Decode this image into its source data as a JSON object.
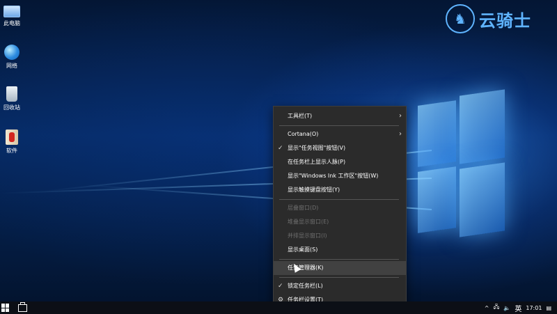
{
  "watermark": {
    "text": "云骑士",
    "logo_icon": "horse-rider-icon"
  },
  "desktop_icons": [
    {
      "label": "此电脑",
      "icon": "computer-icon"
    },
    {
      "label": "网络",
      "icon": "network-icon"
    },
    {
      "label": "回收站",
      "icon": "recycle-bin-icon"
    },
    {
      "label": "软件",
      "icon": "software-folder-icon"
    }
  ],
  "context_menu": {
    "items": [
      {
        "label": "工具栏(T)",
        "submenu": true
      },
      {
        "label": "Cortana(O)",
        "submenu": true
      },
      {
        "label": "显示\"任务视图\"按钮(V)",
        "checked": true
      },
      {
        "label": "在任务栏上显示人脉(P)"
      },
      {
        "label": "显示\"Windows Ink 工作区\"按钮(W)"
      },
      {
        "label": "显示触摸键盘按钮(Y)"
      },
      {
        "label": "层叠窗口(D)",
        "disabled": true
      },
      {
        "label": "堆叠显示窗口(E)",
        "disabled": true
      },
      {
        "label": "并排显示窗口(I)",
        "disabled": true
      },
      {
        "label": "显示桌面(S)"
      },
      {
        "label": "任务管理器(K)",
        "hovered": true
      },
      {
        "label": "锁定任务栏(L)",
        "checked": true
      },
      {
        "label": "任务栏设置(T)",
        "icon": "gear-icon"
      }
    ]
  },
  "taskbar": {
    "tray": {
      "chevron": "^",
      "language": "英",
      "time": "17:01"
    }
  },
  "colors": {
    "menu_bg": "#2b2b2b",
    "menu_hover": "#414141",
    "watermark": "#5fb4ff",
    "taskbar": "#0c0f16"
  }
}
